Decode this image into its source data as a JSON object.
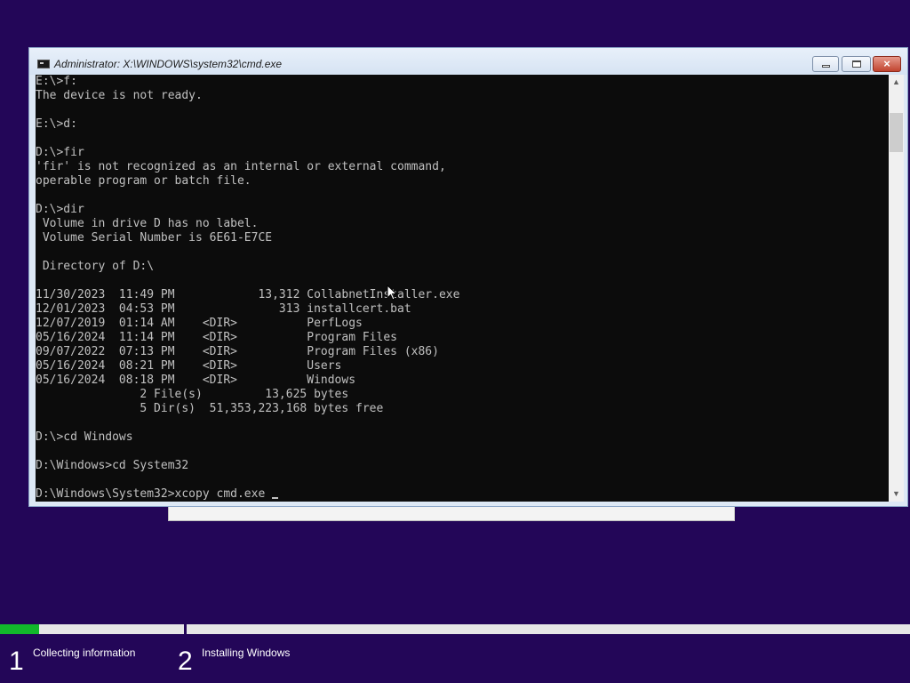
{
  "window": {
    "title": "Administrator: X:\\WINDOWS\\system32\\cmd.exe",
    "icon": "console-icon",
    "buttons": {
      "minimize": "minimize-icon",
      "restore": "restore-icon",
      "close": "×"
    }
  },
  "console": {
    "lines": [
      "E:\\>f:",
      "The device is not ready.",
      "",
      "E:\\>d:",
      "",
      "D:\\>fir",
      "'fir' is not recognized as an internal or external command,",
      "operable program or batch file.",
      "",
      "D:\\>dir",
      " Volume in drive D has no label.",
      " Volume Serial Number is 6E61-E7CE",
      "",
      " Directory of D:\\",
      "",
      "11/30/2023  11:49 PM            13,312 CollabnetInstaller.exe",
      "12/01/2023  04:53 PM               313 installcert.bat",
      "12/07/2019  01:14 AM    <DIR>          PerfLogs",
      "05/16/2024  11:14 PM    <DIR>          Program Files",
      "09/07/2022  07:13 PM    <DIR>          Program Files (x86)",
      "05/16/2024  08:21 PM    <DIR>          Users",
      "05/16/2024  08:18 PM    <DIR>          Windows",
      "               2 File(s)         13,625 bytes",
      "               5 Dir(s)  51,353,223,168 bytes free",
      "",
      "D:\\>cd Windows",
      "",
      "D:\\Windows>cd System32",
      "",
      "D:\\Windows\\System32>xcopy cmd.exe "
    ],
    "text_color": "#c0c0c0",
    "background": "#0c0c0c"
  },
  "setup": {
    "background": "#230658",
    "progress": 0.043,
    "progress_color": "#12b82b",
    "steps": [
      {
        "number": "1",
        "label": "Collecting information"
      },
      {
        "number": "2",
        "label": "Installing Windows"
      }
    ]
  }
}
